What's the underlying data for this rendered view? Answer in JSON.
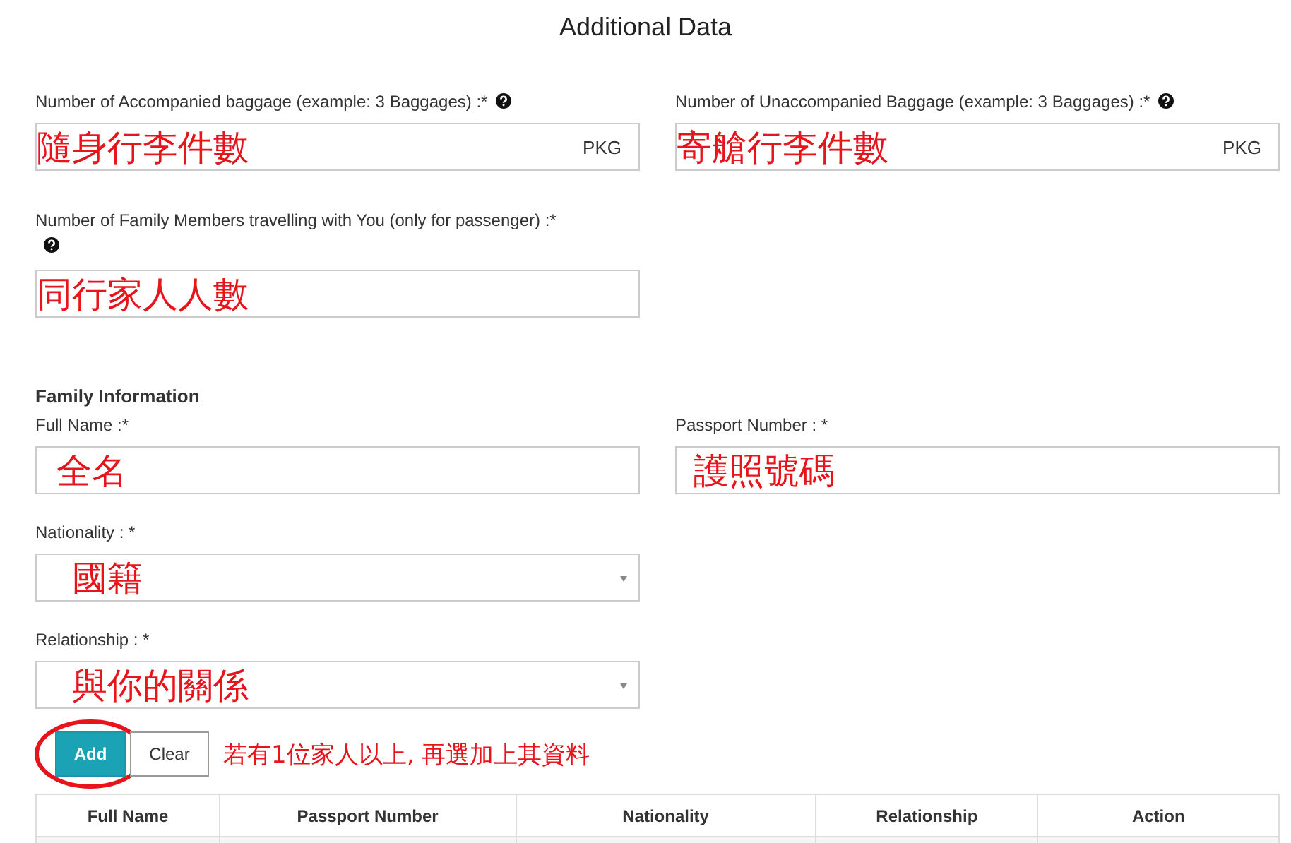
{
  "title": "Additional Data",
  "baggage_fields": [
    {
      "label": "Number of Accompanied baggage (example: 3 Baggages) :*",
      "help": true,
      "unit": "PKG",
      "annotation": "隨身行李件數"
    },
    {
      "label": "Number of Unaccompanied Baggage (example: 3 Baggages) :*",
      "help": true,
      "unit": "PKG",
      "annotation": "寄艙行李件數"
    }
  ],
  "family_count_field": {
    "label": "Number of Family Members travelling with You (only for passenger) :*",
    "help": true,
    "annotation": "同行家人人數"
  },
  "family_information": {
    "heading": "Family Information",
    "fields": [
      {
        "kind": "text",
        "label": "Full Name :*",
        "annotation": "全名"
      },
      {
        "kind": "text",
        "label": "Passport Number : *",
        "annotation": "護照號碼"
      },
      {
        "kind": "select",
        "label": "Nationality : *",
        "annotation": "國籍"
      },
      {
        "kind": "select",
        "label": "Relationship : *",
        "annotation": "與你的關係"
      }
    ]
  },
  "buttons": [
    {
      "label": "Add",
      "kind": "primary",
      "circled": true
    },
    {
      "label": "Clear",
      "kind": "default",
      "circled": false
    }
  ],
  "note": "若有1位家人以上, 再選加上其資料",
  "table": {
    "columns": [
      "Full Name",
      "Passport Number",
      "Nationality",
      "Relationship",
      "Action"
    ]
  }
}
